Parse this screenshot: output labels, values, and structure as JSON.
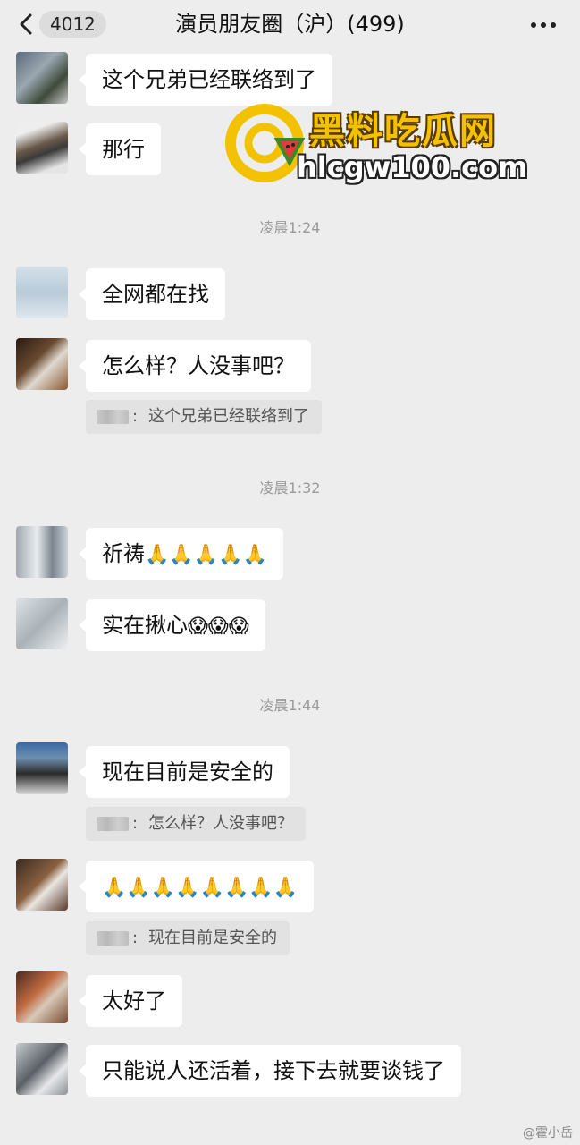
{
  "header": {
    "back_count": "4012",
    "title": "演员朋友圈（沪）(499)"
  },
  "messages": [
    {
      "text": "这个兄弟已经联络到了"
    },
    {
      "text": "那行"
    },
    {
      "time": "凌晨1:24"
    },
    {
      "text": "全网都在找"
    },
    {
      "text": "怎么样？人没事吧？"
    },
    {
      "quote": "这个兄弟已经联络到了"
    },
    {
      "time": "凌晨1:32"
    },
    {
      "text": "祈祷",
      "emoji": "🙏🙏🙏🙏🙏"
    },
    {
      "text": "实在揪心",
      "emoji": "😱😱😱"
    },
    {
      "time": "凌晨1:44"
    },
    {
      "text": "现在目前是安全的"
    },
    {
      "quote": "怎么样？人没事吧？"
    },
    {
      "emoji": "🙏🙏🙏🙏🙏🙏🙏🙏"
    },
    {
      "quote": "现在目前是安全的"
    },
    {
      "text": "太好了"
    },
    {
      "text": "只能说人还活着，接下去就要谈钱了"
    }
  ],
  "watermark": {
    "name": "黑料吃瓜网",
    "url": "hlcgw100.com"
  },
  "credit": "@霍小岳"
}
